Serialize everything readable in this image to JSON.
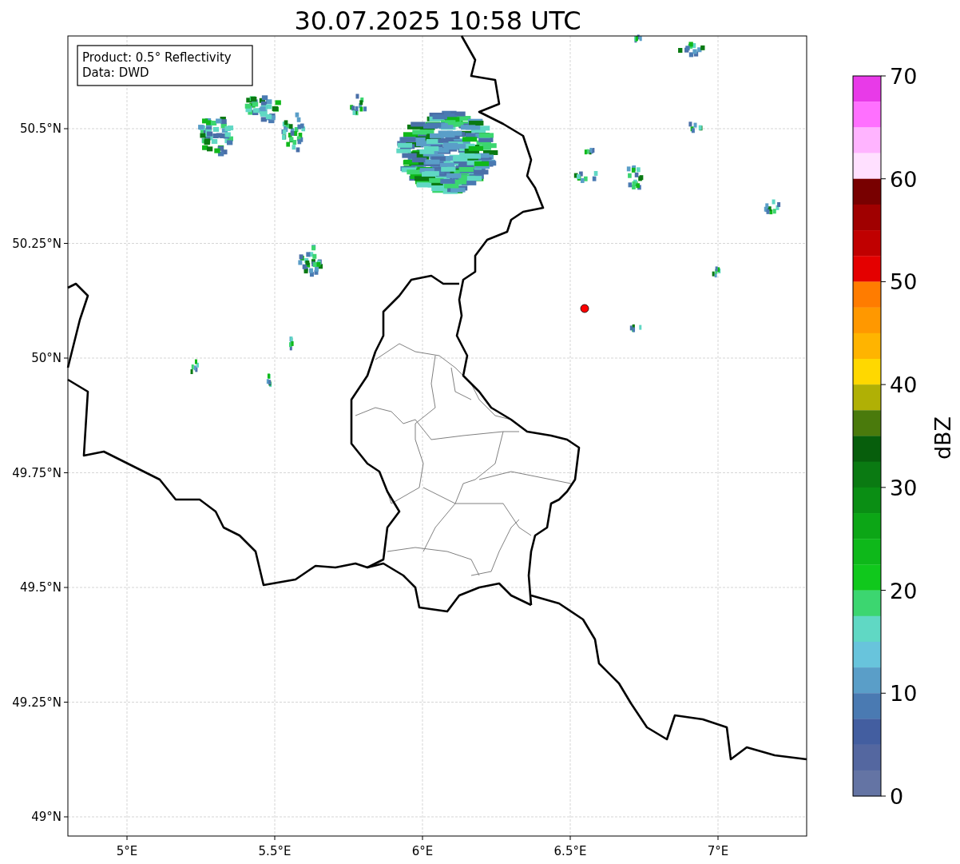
{
  "title": "30.07.2025 10:58 UTC",
  "info_box": [
    "Product: 0.5° Reflectivity",
    "Data: DWD"
  ],
  "map": {
    "x_ticks": [
      "5°E",
      "5.5°E",
      "6°E",
      "6.5°E",
      "7°E"
    ],
    "y_ticks": [
      "50.5°N",
      "50.25°N",
      "50°N",
      "49.75°N",
      "49.5°N",
      "49.25°N",
      "49°N"
    ]
  },
  "colorbar": {
    "label": "dBZ",
    "ticks": [
      "70",
      "60",
      "50",
      "40",
      "30",
      "20",
      "10",
      "0"
    ],
    "segments": [
      {
        "color": "#e83ae8"
      },
      {
        "color": "#ff70ff"
      },
      {
        "color": "#ffb4ff"
      },
      {
        "color": "#ffe0ff"
      },
      {
        "color": "#780000"
      },
      {
        "color": "#a00000"
      },
      {
        "color": "#c00000"
      },
      {
        "color": "#e40000"
      },
      {
        "color": "#ff7c00"
      },
      {
        "color": "#ff9800"
      },
      {
        "color": "#ffb400"
      },
      {
        "color": "#ffd800"
      },
      {
        "color": "#b0b005"
      },
      {
        "color": "#4a7a0c"
      },
      {
        "color": "#075e0c"
      },
      {
        "color": "#0a7a12"
      },
      {
        "color": "#0a8e14"
      },
      {
        "color": "#0ca616"
      },
      {
        "color": "#0eb81a"
      },
      {
        "color": "#10c81c"
      },
      {
        "color": "#3cd670"
      },
      {
        "color": "#60d8c4"
      },
      {
        "color": "#68c4dc"
      },
      {
        "color": "#5a9ec8"
      },
      {
        "color": "#4a7ab2"
      },
      {
        "color": "#435ea0"
      },
      {
        "color": "#5467a0"
      },
      {
        "color": "#6474a4"
      }
    ]
  }
}
